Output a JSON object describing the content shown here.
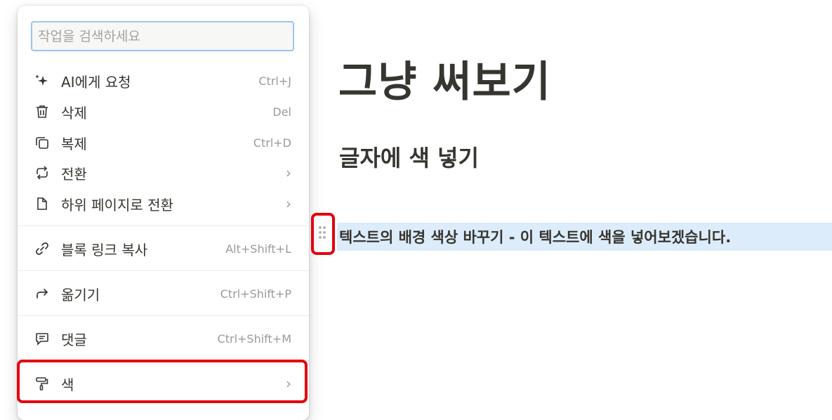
{
  "menu": {
    "search": {
      "placeholder": "작업을 검색하세요",
      "value": ""
    },
    "items": [
      {
        "label": "AI에게 요청",
        "shortcut": "Ctrl+J",
        "icon": "sparkle-icon"
      },
      {
        "label": "삭제",
        "shortcut": "Del",
        "icon": "trash-icon"
      },
      {
        "label": "복제",
        "shortcut": "Ctrl+D",
        "icon": "duplicate-icon"
      },
      {
        "label": "전환",
        "shortcut": "›",
        "icon": "turn-into-icon"
      },
      {
        "label": "하위 페이지로 전환",
        "shortcut": "›",
        "icon": "page-icon"
      },
      {
        "label": "블록 링크 복사",
        "shortcut": "Alt+Shift+L",
        "icon": "link-icon"
      },
      {
        "label": "옮기기",
        "shortcut": "Ctrl+Shift+P",
        "icon": "move-arrow-icon"
      },
      {
        "label": "댓글",
        "shortcut": "Ctrl+Shift+M",
        "icon": "comment-icon"
      },
      {
        "label": "색",
        "shortcut": "›",
        "icon": "paint-roller-icon"
      }
    ]
  },
  "page": {
    "title": "그냥 써보기",
    "heading": "글자에 색 넣기",
    "block_text": "텍스트의 배경 색상 바꾸기 - 이 텍스트에 색을 넣어보겠습니다."
  },
  "colors": {
    "highlight_box": "#e3000f",
    "selected_block_bg": "#dcecfa",
    "search_focus_border": "#9ec3ef"
  }
}
